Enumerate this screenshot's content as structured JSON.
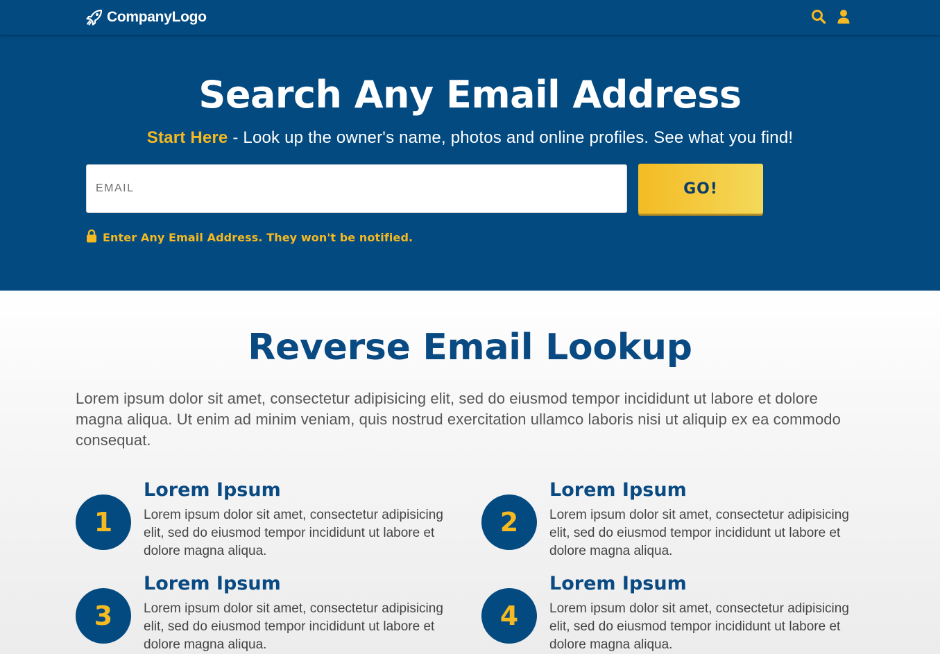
{
  "navbar": {
    "logo_text": "CompanyLogo",
    "logo_icon": "rocket-icon",
    "search_icon": "search-icon",
    "user_icon": "user-icon"
  },
  "hero": {
    "title": "Search Any Email Address",
    "subtitle_highlight": "Start Here",
    "subtitle_rest": " - Look up the owner's name, photos and online profiles. See what you find!",
    "email_placeholder": "EMAIL",
    "email_value": "",
    "go_label": "GO!",
    "notice_icon": "lock-icon",
    "notice_text": "Enter Any Email Address. They won't be notified."
  },
  "content": {
    "title": "Reverse Email Lookup",
    "text": "Lorem ipsum dolor sit amet, consectetur adipisicing elit, sed do eiusmod tempor incididunt ut labore et dolore magna aliqua. Ut enim ad minim veniam, quis nostrud exercitation ullamco laboris nisi ut aliquip ex ea commodo consequat.",
    "features": [
      {
        "number": "1",
        "title": "Lorem Ipsum",
        "text": "Lorem ipsum dolor sit amet, consectetur adipisicing elit, sed do eiusmod tempor incididunt ut labore et dolore magna aliqua."
      },
      {
        "number": "2",
        "title": "Lorem Ipsum",
        "text": "Lorem ipsum dolor sit amet, consectetur adipisicing elit, sed do eiusmod tempor incididunt ut labore et dolore magna aliqua."
      },
      {
        "number": "3",
        "title": "Lorem Ipsum",
        "text": "Lorem ipsum dolor sit amet, consectetur adipisicing elit, sed do eiusmod tempor incididunt ut labore et dolore magna aliqua."
      },
      {
        "number": "4",
        "title": "Lorem Ipsum",
        "text": "Lorem ipsum dolor sit amet, consectetur adipisicing elit, sed do eiusmod tempor incididunt ut labore et dolore magna aliqua."
      }
    ]
  },
  "colors": {
    "primary_blue": "#034a81",
    "accent_yellow": "#f5b921",
    "heading_blue": "#0a4a82"
  }
}
